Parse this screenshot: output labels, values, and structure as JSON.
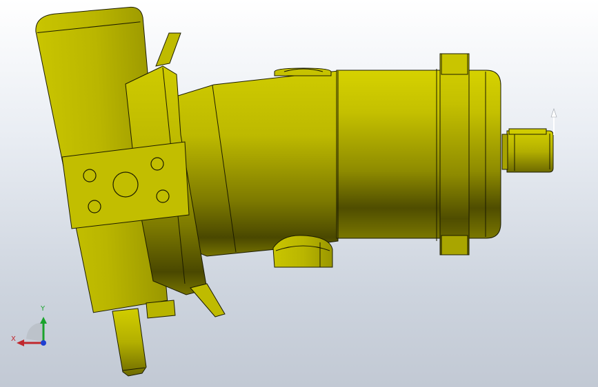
{
  "viewport": {
    "background_top": "#ffffff",
    "background_bottom": "#c2c9d4",
    "model_color": "#c8c400",
    "model_shadow": "#4d4b00",
    "outline_color": "#1a1a00"
  },
  "triad": {
    "x_label": "X",
    "y_label": "Y",
    "x_color": "#c0272d",
    "y_color": "#1aa32c",
    "z_color": "#1f3fd1"
  }
}
